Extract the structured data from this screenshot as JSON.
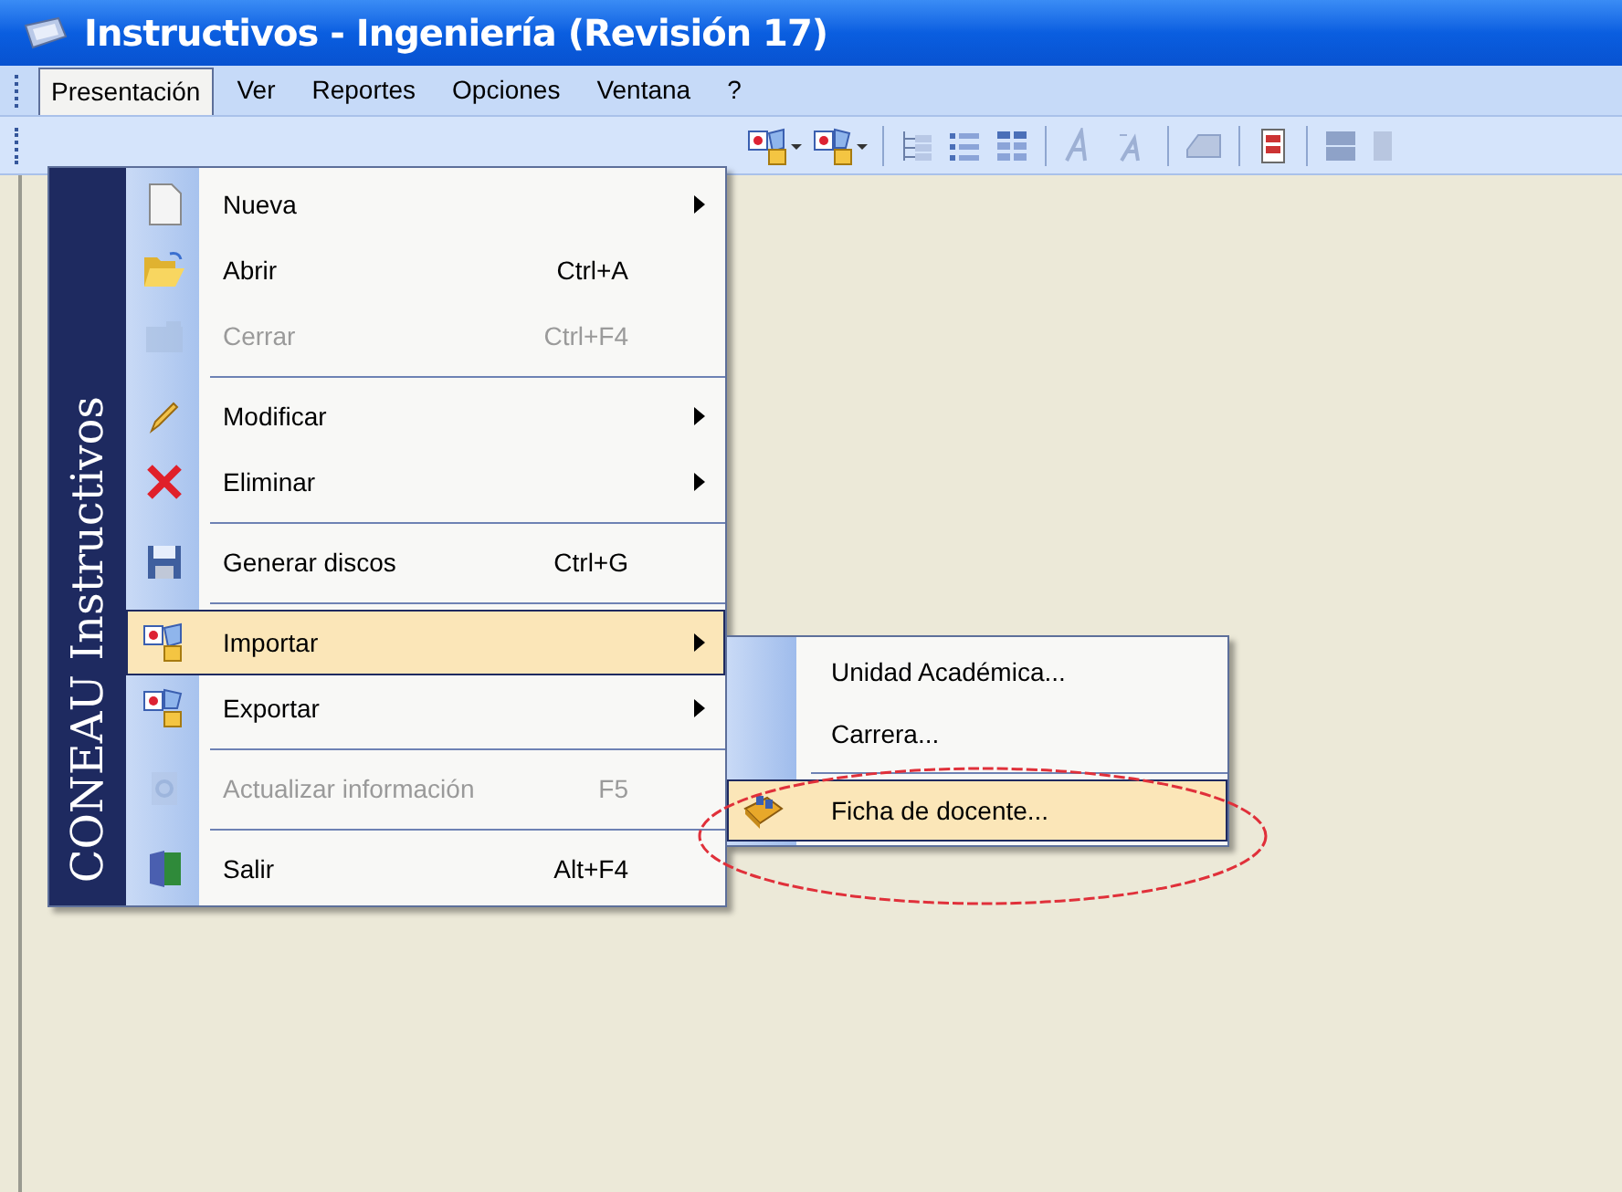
{
  "window": {
    "title": "Instructivos - Ingeniería (Revisión 17)"
  },
  "menu_bar": [
    {
      "label": "Presentación",
      "selected": true
    },
    {
      "label": "Ver",
      "selected": false
    },
    {
      "label": "Reportes",
      "selected": false
    },
    {
      "label": "Opciones",
      "selected": false
    },
    {
      "label": "Ventana",
      "selected": false
    },
    {
      "label": "?",
      "selected": false
    }
  ],
  "menu": {
    "banner": "CONEAU Instructivos",
    "items": [
      {
        "kind": "item",
        "label": "Nueva",
        "submenu": true,
        "disabled": false,
        "selected": false
      },
      {
        "kind": "item",
        "label": "Abrir",
        "shortcut": "Ctrl+A",
        "submenu": false,
        "disabled": false,
        "selected": false
      },
      {
        "kind": "item",
        "label": "Cerrar",
        "shortcut": "Ctrl+F4",
        "submenu": false,
        "disabled": true,
        "selected": false
      },
      {
        "kind": "separator"
      },
      {
        "kind": "item",
        "label": "Modificar",
        "submenu": true,
        "disabled": false,
        "selected": false
      },
      {
        "kind": "item",
        "label": "Eliminar",
        "submenu": true,
        "disabled": false,
        "selected": false
      },
      {
        "kind": "separator"
      },
      {
        "kind": "item",
        "label": "Generar discos",
        "shortcut": "Ctrl+G",
        "submenu": false,
        "disabled": false,
        "selected": false
      },
      {
        "kind": "separator"
      },
      {
        "kind": "item",
        "label": "Importar",
        "submenu": true,
        "disabled": false,
        "selected": true
      },
      {
        "kind": "item",
        "label": "Exportar",
        "submenu": true,
        "disabled": false,
        "selected": false
      },
      {
        "kind": "separator"
      },
      {
        "kind": "item",
        "label": "Actualizar información",
        "shortcut": "F5",
        "submenu": false,
        "disabled": true,
        "selected": false
      },
      {
        "kind": "separator"
      },
      {
        "kind": "item",
        "label": "Salir",
        "shortcut": "Alt+F4",
        "submenu": false,
        "disabled": false,
        "selected": false
      }
    ]
  },
  "submenu": {
    "items": [
      {
        "kind": "item",
        "label": "Unidad Académica...",
        "selected": false
      },
      {
        "kind": "item",
        "label": "Carrera...",
        "selected": false
      },
      {
        "kind": "separator"
      },
      {
        "kind": "item",
        "label": "Ficha de docente...",
        "selected": true
      }
    ]
  }
}
